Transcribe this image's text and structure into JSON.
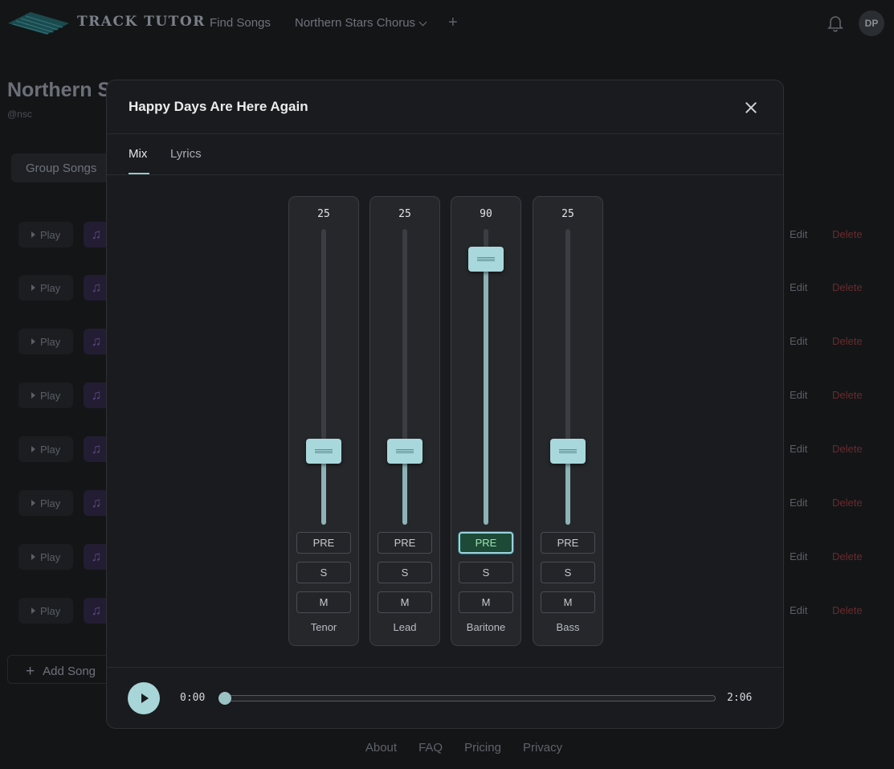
{
  "app": {
    "brand": "TRACK TUTOR",
    "nav": {
      "find_songs": "Find Songs",
      "group": "Northern Stars Chorus",
      "add": "+"
    },
    "avatar_initials": "DP"
  },
  "page": {
    "title": "Northern S",
    "subtitle": "@nsc",
    "tab": "Group Songs",
    "rows": [
      {
        "play": "Play",
        "edit": "Edit",
        "delete": "Delete"
      },
      {
        "play": "Play",
        "edit": "Edit",
        "delete": "Delete"
      },
      {
        "play": "Play",
        "edit": "Edit",
        "delete": "Delete"
      },
      {
        "play": "Play",
        "edit": "Edit",
        "delete": "Delete"
      },
      {
        "play": "Play",
        "edit": "Edit",
        "delete": "Delete"
      },
      {
        "play": "Play",
        "edit": "Edit",
        "delete": "Delete"
      },
      {
        "play": "Play",
        "edit": "Edit",
        "delete": "Delete"
      },
      {
        "play": "Play",
        "edit": "Edit",
        "delete": "Delete"
      }
    ],
    "add_song": "Add Song"
  },
  "footer": {
    "links": [
      "About",
      "FAQ",
      "Pricing",
      "Privacy"
    ]
  },
  "modal": {
    "title": "Happy Days Are Here Again",
    "tabs": [
      {
        "label": "Mix",
        "active": true
      },
      {
        "label": "Lyrics",
        "active": false
      }
    ],
    "channels": [
      {
        "name": "Tenor",
        "value": 25,
        "pre": "PRE",
        "solo": "S",
        "mute": "M",
        "pre_on": false
      },
      {
        "name": "Lead",
        "value": 25,
        "pre": "PRE",
        "solo": "S",
        "mute": "M",
        "pre_on": false
      },
      {
        "name": "Baritone",
        "value": 90,
        "pre": "PRE",
        "solo": "S",
        "mute": "M",
        "pre_on": true
      },
      {
        "name": "Bass",
        "value": 25,
        "pre": "PRE",
        "solo": "S",
        "mute": "M",
        "pre_on": false
      }
    ],
    "player": {
      "current": "0:00",
      "total": "2:06",
      "progress": 0
    }
  },
  "colors": {
    "accent": "#a7d5d8",
    "delete": "#6a2a2d",
    "pre_on_bg": "#1c4a36"
  }
}
